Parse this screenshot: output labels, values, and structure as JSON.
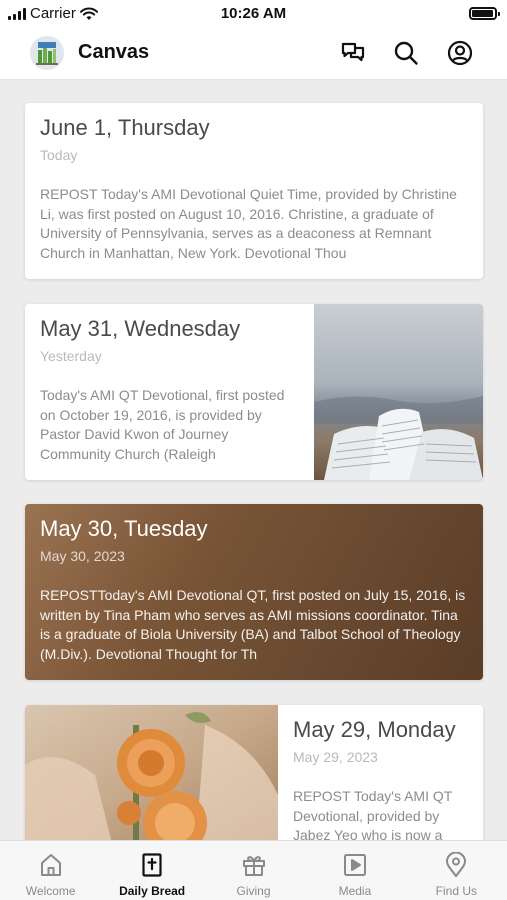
{
  "status": {
    "carrier": "Carrier",
    "time": "10:26 AM"
  },
  "app": {
    "title": "Canvas"
  },
  "cards": [
    {
      "date": "June 1, Thursday",
      "sub": "Today",
      "body": "REPOST Today's AMI Devotional Quiet Time, provided by Christine Li, was first posted on August 10, 2016. Christine, a graduate of University of Pennsylvania, serves as a deaconess at Remnant Church in Manhattan, New York.  Devotional Thou"
    },
    {
      "date": "May 31, Wednesday",
      "sub": "Yesterday",
      "body": "Today's AMI QT Devotional, first posted on October 19, 2016, is provided by Pastor David Kwon of Journey Community Church (Raleigh"
    },
    {
      "date": "May 30, Tuesday",
      "sub": "May 30, 2023",
      "body": "REPOSTToday's AMI Devotional QT, first posted on July 15, 2016, is written by Tina Pham who serves as AMI missions coordinator.  Tina is a graduate of Biola University (BA) and Talbot School of Theology (M.Div.).  Devotional Thought for Th"
    },
    {
      "date": "May 29, Monday",
      "sub": "May 29, 2023",
      "body": "REPOST Today's AMI QT Devotional, provided by Jabez Yeo who is now a"
    }
  ],
  "tabs": [
    {
      "label": "Welcome",
      "icon": "home-icon",
      "active": false
    },
    {
      "label": "Daily Bread",
      "icon": "bible-icon",
      "active": true
    },
    {
      "label": "Giving",
      "icon": "gift-icon",
      "active": false
    },
    {
      "label": "Media",
      "icon": "play-icon",
      "active": false
    },
    {
      "label": "Find Us",
      "icon": "location-pin-icon",
      "active": false
    }
  ],
  "colors": {
    "accent": "#111111",
    "inactive": "#8a8a8a",
    "background": "#ececec"
  }
}
